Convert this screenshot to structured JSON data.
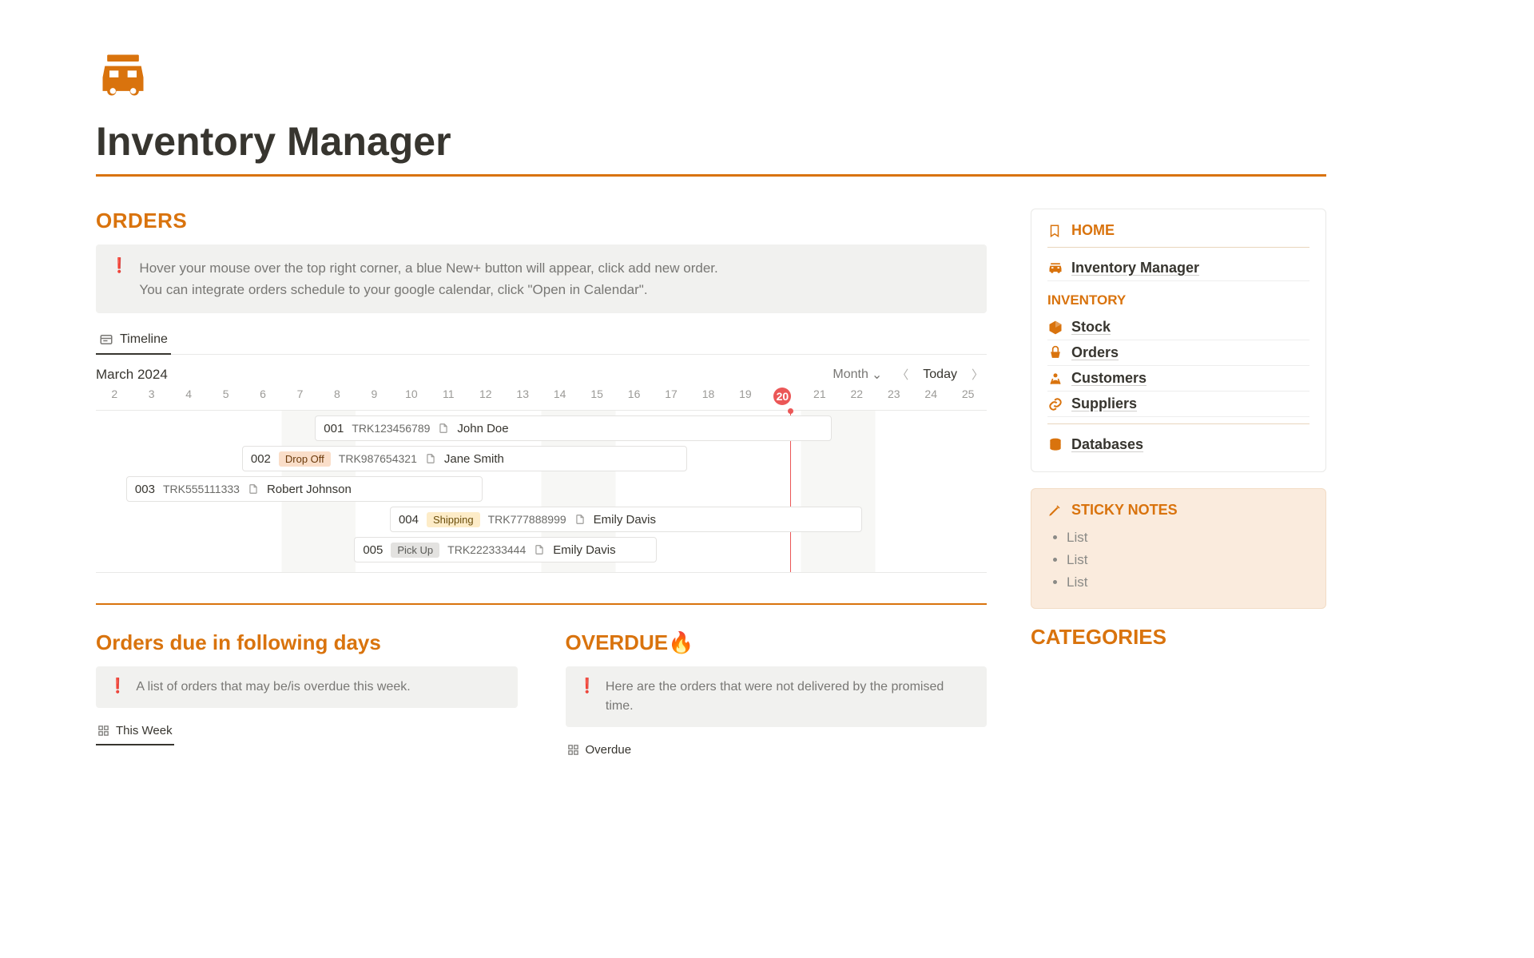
{
  "page": {
    "title": "Inventory Manager"
  },
  "orders": {
    "title": "ORDERS",
    "hint_line1": "Hover your mouse over the top right corner, a blue New+ button will appear, click add new order.",
    "hint_line2": "You can integrate orders schedule to your google calendar, click \"Open in Calendar\".",
    "view_tab": "Timeline",
    "month_label": "March 2024",
    "scale_label": "Month",
    "today_label": "Today",
    "days": [
      "2",
      "3",
      "4",
      "5",
      "6",
      "7",
      "8",
      "9",
      "10",
      "11",
      "12",
      "13",
      "14",
      "15",
      "16",
      "17",
      "18",
      "19",
      "20",
      "21",
      "22",
      "23",
      "24",
      "25"
    ],
    "today_index": 18,
    "items": [
      {
        "id": "001",
        "tag": null,
        "tracking": "TRK123456789",
        "name": "John Doe",
        "left_pct": 24.6,
        "width_pct": 58.0
      },
      {
        "id": "002",
        "tag": "Drop Off",
        "tag_class": "tag-dropoff",
        "tracking": "TRK987654321",
        "name": "Jane Smith",
        "left_pct": 16.4,
        "width_pct": 50.0
      },
      {
        "id": "003",
        "tag": null,
        "tracking": "TRK555111333",
        "name": "Robert Johnson",
        "left_pct": 3.4,
        "width_pct": 40.0
      },
      {
        "id": "004",
        "tag": "Shipping",
        "tag_class": "tag-shipping",
        "tracking": "TRK777888999",
        "name": "Emily Davis",
        "left_pct": 33.0,
        "width_pct": 53.0
      },
      {
        "id": "005",
        "tag": "Pick Up",
        "tag_class": "tag-pickup",
        "tracking": "TRK222333444",
        "name": "Emily Davis",
        "left_pct": 29.0,
        "width_pct": 34.0
      }
    ]
  },
  "due": {
    "title": "Orders due in following days",
    "hint": "A list of orders that may be/is overdue this week.",
    "view_tab": "This Week"
  },
  "overdue": {
    "title": "OVERDUE🔥",
    "hint": "Here are the orders that were not delivered by the promised time.",
    "view_tab": "Overdue"
  },
  "sidebar": {
    "home": {
      "header": "HOME",
      "link": "Inventory Manager"
    },
    "inventory": {
      "header": "INVENTORY",
      "links": [
        "Stock",
        "Orders",
        "Customers",
        "Suppliers"
      ]
    },
    "databases": "Databases",
    "notes": {
      "header": "STICKY NOTES",
      "items": [
        "List",
        "List",
        "List"
      ]
    },
    "categories": {
      "header": "CATEGORIES"
    }
  }
}
